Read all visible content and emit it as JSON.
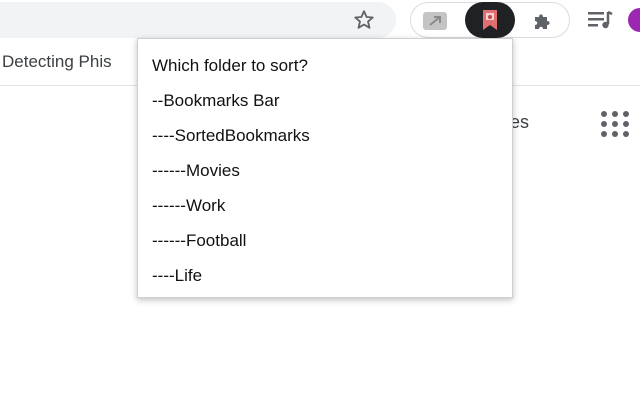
{
  "toolbar": {
    "icons": {
      "star": "star-outline-icon",
      "screen_ext": "screen-extension-icon",
      "active_ext": "bookmark-sorter-extension-icon",
      "puzzle": "puzzle-piece-icon",
      "queue": "media-queue-icon"
    },
    "active_ext_bg": "#202124",
    "accent": "#9c27b0"
  },
  "bookmarks_bar": {
    "item_label": "Detecting Phis"
  },
  "page": {
    "partial_text": "ges"
  },
  "popup": {
    "title": "Which folder to sort?",
    "folders": [
      "--Bookmarks Bar",
      "----SortedBookmarks",
      "------Movies",
      "------Work",
      "------Football",
      "----Life"
    ]
  }
}
